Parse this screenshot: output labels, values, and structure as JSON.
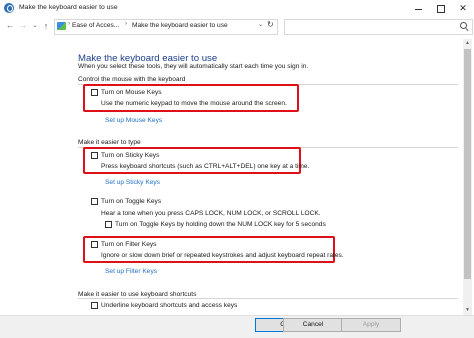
{
  "window": {
    "title": "Make the keyboard easier to use",
    "minimize_glyph": "",
    "close_glyph": "✕"
  },
  "nav": {
    "back_glyph": "←",
    "forward_glyph": "→",
    "recent_glyph": "⌄",
    "up_glyph": "↑",
    "breadcrumb": [
      "Ease of Acces...",
      "Make the keyboard easier to use"
    ],
    "separator_glyph": "›",
    "dropdown_glyph": "⌄",
    "refresh_glyph": "↻",
    "search_placeholder": ""
  },
  "main": {
    "title": "Make the keyboard easier to use",
    "intro": "When you select these tools, they will automatically start each time you sign in.",
    "sections": [
      {
        "heading": "Control the mouse with the keyboard",
        "options": [
          {
            "label": "Turn on Mouse Keys",
            "checked": false,
            "description": "Use the numeric keypad to move the mouse around the screen.",
            "link": "Set up Mouse Keys",
            "highlighted": true
          }
        ]
      },
      {
        "heading": "Make it easier to type",
        "options": [
          {
            "label": "Turn on Sticky Keys",
            "checked": false,
            "description": "Press keyboard shortcuts (such as CTRL+ALT+DEL) one key at a time.",
            "link": "Set up Sticky Keys",
            "highlighted": true
          },
          {
            "label": "Turn on Toggle Keys",
            "checked": false,
            "description": "Hear a tone when you press CAPS LOCK, NUM LOCK, or SCROLL LOCK.",
            "sub_option": "Turn on Toggle Keys by holding down the NUM LOCK key for 5 seconds",
            "highlighted": false
          },
          {
            "label": "Turn on Filter Keys",
            "checked": false,
            "description": "Ignore or slow down brief or repeated keystrokes and adjust keyboard repeat rates.",
            "link": "Set up Filter Keys",
            "highlighted": true
          }
        ]
      },
      {
        "heading": "Make it easier to use keyboard shortcuts",
        "options": [
          {
            "label": "Underline keyboard shortcuts and access keys",
            "checked": false
          }
        ]
      }
    ]
  },
  "buttons": {
    "ok": "OK",
    "cancel": "Cancel",
    "apply": "Apply"
  },
  "colors": {
    "title_blue": "#1e3f8a",
    "link_blue": "#1f6fc5",
    "highlight_red": "#e0101a"
  }
}
